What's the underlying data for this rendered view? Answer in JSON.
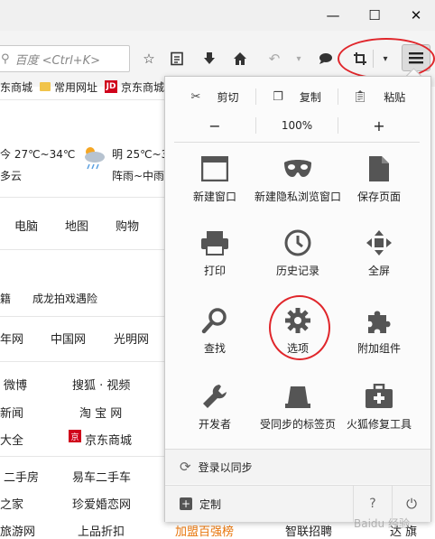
{
  "window": {
    "minimize_label": "—",
    "maximize_label": "☐",
    "close_label": "✕"
  },
  "search": {
    "placeholder": "百度 <Ctrl+K>"
  },
  "bookmarks": [
    {
      "label": "东商城",
      "type": "plain"
    },
    {
      "label": "常用网址",
      "type": "folder"
    },
    {
      "label": "京东商城",
      "type": "jd"
    }
  ],
  "jd_badge": "JD",
  "weather": {
    "today_temp": "今 27℃~34℃",
    "today_desc": "多云",
    "tomorrow_temp": "明 25℃~3",
    "tomorrow_desc": "阵雨~中雨"
  },
  "nav": [
    "电脑",
    "地图",
    "购物"
  ],
  "news": [
    "籍",
    "成龙拍戏遇险"
  ],
  "sites_row": [
    "年网",
    "中国网",
    "光明网"
  ],
  "links": [
    [
      "微博",
      "搜狐 · 视频"
    ],
    [
      "新闻",
      "淘 宝 网"
    ],
    [
      "大全",
      "京东商城"
    ],
    [
      "二手房",
      "易车二手车"
    ],
    [
      "之家",
      "珍爱婚恋网"
    ],
    [
      "旅游网",
      "上品折扣"
    ]
  ],
  "bottom_extra": [
    "加盟百强榜",
    "智联招聘",
    "达 旗"
  ],
  "menu": {
    "edit": {
      "cut": "剪切",
      "copy": "复制",
      "paste": "粘贴"
    },
    "zoom": {
      "minus": "−",
      "level": "100%",
      "plus": "+"
    },
    "items": [
      {
        "label": "新建窗口",
        "icon": "new-window-icon"
      },
      {
        "label": "新建隐私浏览窗口",
        "icon": "private-mask-icon"
      },
      {
        "label": "保存页面",
        "icon": "save-page-icon"
      },
      {
        "label": "打印",
        "icon": "printer-icon"
      },
      {
        "label": "历史记录",
        "icon": "history-clock-icon"
      },
      {
        "label": "全屏",
        "icon": "fullscreen-icon"
      },
      {
        "label": "查找",
        "icon": "find-magnifier-icon"
      },
      {
        "label": "选项",
        "icon": "options-gear-icon"
      },
      {
        "label": "附加组件",
        "icon": "addons-puzzle-icon"
      },
      {
        "label": "开发者",
        "icon": "developer-wrench-icon"
      },
      {
        "label": "受同步的标签页",
        "icon": "synced-tabs-icon"
      },
      {
        "label": "火狐修复工具",
        "icon": "repair-toolkit-icon"
      }
    ],
    "sync_label": "登录以同步",
    "customize_label": "定制"
  },
  "watermark": "Baidu 经验"
}
